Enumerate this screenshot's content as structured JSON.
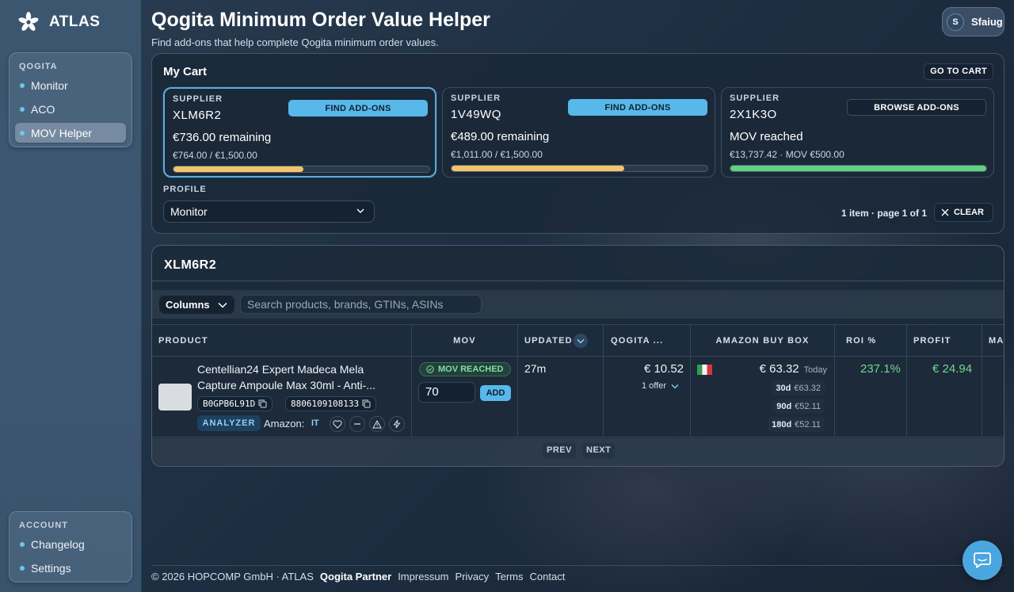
{
  "app": {
    "name": "ATLAS"
  },
  "sidebar": {
    "main_section": "QOGITA",
    "items": [
      {
        "label": "Monitor"
      },
      {
        "label": "ACO"
      },
      {
        "label": "MOV Helper",
        "active": true
      }
    ],
    "account_section": "ACCOUNT",
    "account_items": [
      {
        "label": "Changelog"
      },
      {
        "label": "Settings"
      }
    ]
  },
  "header": {
    "title": "Qogita Minimum Order Value Helper",
    "subtitle": "Find add-ons that help complete Qogita minimum order values."
  },
  "user": {
    "initial": "S",
    "name": "Sfaiug"
  },
  "cart": {
    "title": "My Cart",
    "go_to_cart": "GO TO CART",
    "suppliers": [
      {
        "label": "SUPPLIER",
        "code": "XLM6R2",
        "button": "FIND ADD-ONS",
        "status": "€736.00 remaining",
        "sub": "€764.00 / €1,500.00",
        "progress": 0.509,
        "color": "#f2c46b"
      },
      {
        "label": "SUPPLIER",
        "code": "1V49WQ",
        "button": "FIND ADD-ONS",
        "status": "€489.00 remaining",
        "sub": "€1,011.00 / €1,500.00",
        "progress": 0.674,
        "color": "#f2c46b"
      },
      {
        "label": "SUPPLIER",
        "code": "2X1K3O",
        "button": "BROWSE ADD-ONS",
        "status": "MOV reached",
        "sub": "€13,737.42 · MOV €500.00",
        "progress": 1.0,
        "color": "#5fd17f"
      }
    ],
    "profile_label": "PROFILE",
    "profile_value": "Monitor",
    "page_info": "1 item · page 1 of 1",
    "clear": "CLEAR"
  },
  "table": {
    "title": "XLM6R2",
    "columns_button": "Columns",
    "search_placeholder": "Search products, brands, GTINs, ASINs",
    "headers": {
      "product": "PRODUCT",
      "mov": "MOV",
      "updated": "UPDATED",
      "qogita": "QOGITA ...",
      "amazon": "AMAZON BUY BOX",
      "roi": "ROI %",
      "profit": "PROFIT",
      "ma": "MA"
    },
    "rows": [
      {
        "product": "Centellian24 Expert Madeca Mela Capture Ampoule Max 30ml - Anti-...",
        "asin": "B0GPB6L91D",
        "gtin": "8806109108133",
        "analyzer": "ANALYZER",
        "amazon_label": "Amazon:",
        "amazon_market": "IT",
        "mov_badge": "MOV REACHED",
        "qty": "70",
        "add": "ADD",
        "updated": "27m",
        "qogita_price": "€ 10.52",
        "offers": "1 offer",
        "buybox": "€ 63.32",
        "buybox_when": "Today",
        "hist": [
          {
            "period": "30d",
            "value": "€63.32"
          },
          {
            "period": "90d",
            "value": "€52.11"
          },
          {
            "period": "180d",
            "value": "€52.11"
          }
        ],
        "roi": "237.1%",
        "profit": "€ 24.94"
      }
    ],
    "prev": "PREV",
    "next": "NEXT"
  },
  "footer": {
    "copyright": "© 2026 HOPCOMP GmbH · ATLAS",
    "partner": "Qogita Partner",
    "links": [
      "Impressum",
      "Privacy",
      "Terms",
      "Contact"
    ]
  }
}
